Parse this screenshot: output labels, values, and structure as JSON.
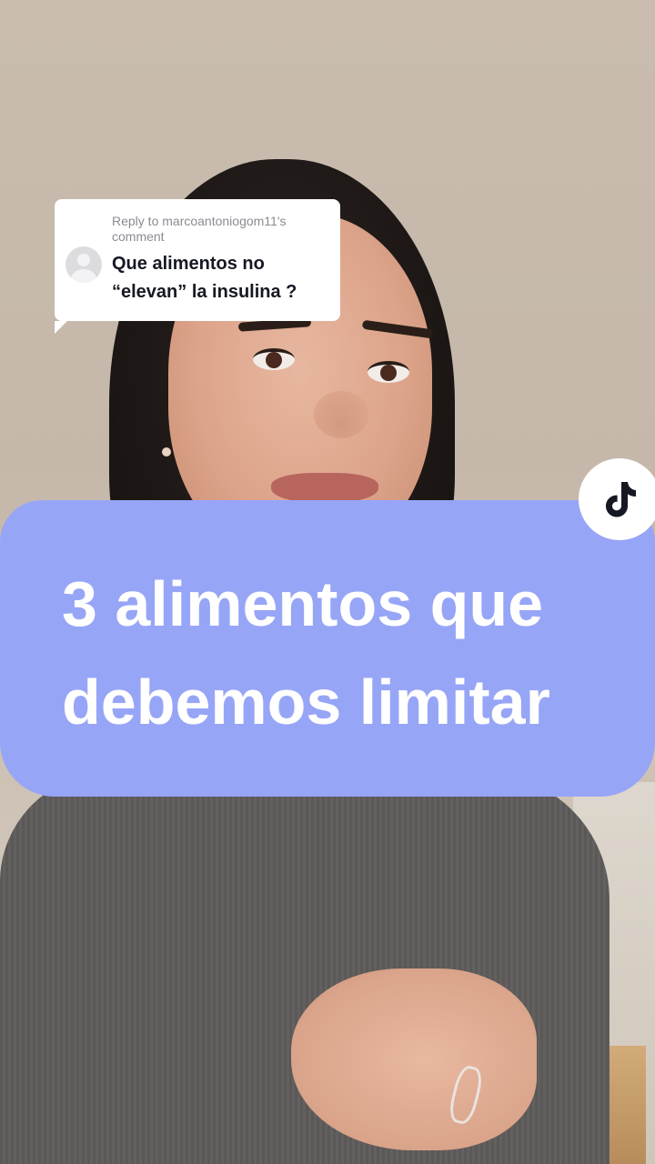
{
  "reply": {
    "header": "Reply to marcoantoniogom11's comment",
    "comment_text": "Que alimentos no “elevan” la insulina ?"
  },
  "caption": {
    "line1": "3 alimentos que",
    "line2": "debemos limitar",
    "background_color": "#97a5f7",
    "text_color": "#ffffff"
  },
  "badge": {
    "icon": "tiktok-logo-icon"
  }
}
